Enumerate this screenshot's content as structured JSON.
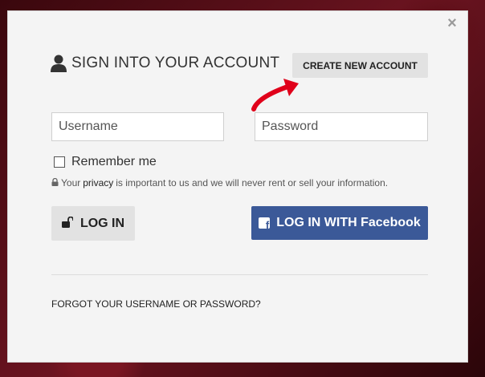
{
  "modal": {
    "close_label": "×",
    "heading": "SIGN INTO YOUR ACCOUNT",
    "create_account_label": "CREATE NEW ACCOUNT"
  },
  "form": {
    "username": {
      "placeholder": "Username",
      "value": ""
    },
    "password": {
      "placeholder": "Password",
      "value": ""
    },
    "remember_label": "Remember me",
    "remember_checked": false
  },
  "privacy": {
    "before": "Your",
    "link": "privacy",
    "after": "is important to us and we will never rent or sell your information."
  },
  "buttons": {
    "login_label": "LOG IN",
    "facebook_label": "LOG IN WITH Facebook"
  },
  "footer": {
    "forgot_label": "FORGOT YOUR USERNAME OR PASSWORD?"
  },
  "colors": {
    "facebook": "#3b5998",
    "annotation_arrow": "#e0001a",
    "button_gray": "#e2e2e2"
  },
  "icons": [
    "user-icon",
    "lock-icon",
    "unlock-icon",
    "facebook-icon",
    "close-icon"
  ]
}
